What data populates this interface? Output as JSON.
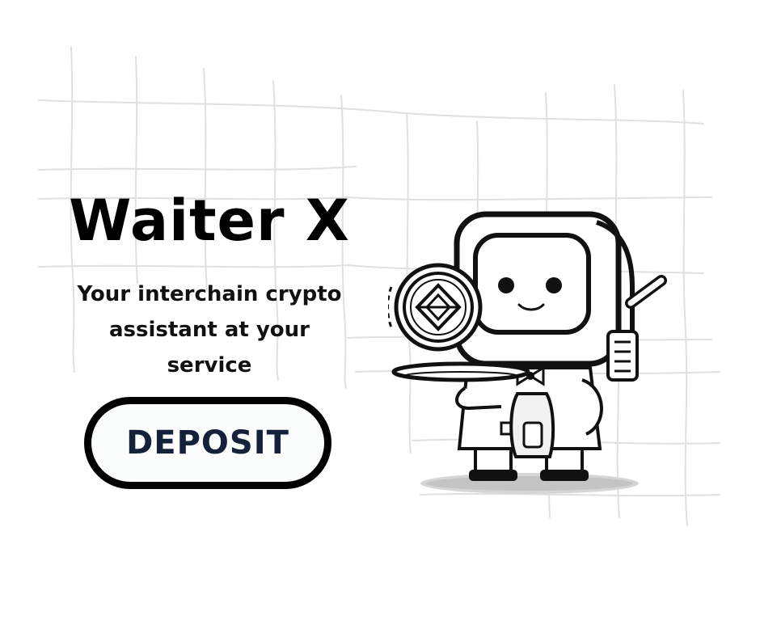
{
  "hero": {
    "title": "Waiter X",
    "subtitle_lines": [
      "Your interchain crypto",
      "assistant at your",
      "service"
    ]
  },
  "cta": {
    "label": "DEPOSIT"
  },
  "illustration": {
    "icon": "robot-waiter-icon",
    "coin_icon": "crypto-coin-icon",
    "background": "hand-drawn-grid"
  },
  "colors": {
    "background": "#ffffff",
    "text": "#000000",
    "button_text": "#14213a",
    "button_border": "#000000",
    "grid": "#dddddd"
  }
}
